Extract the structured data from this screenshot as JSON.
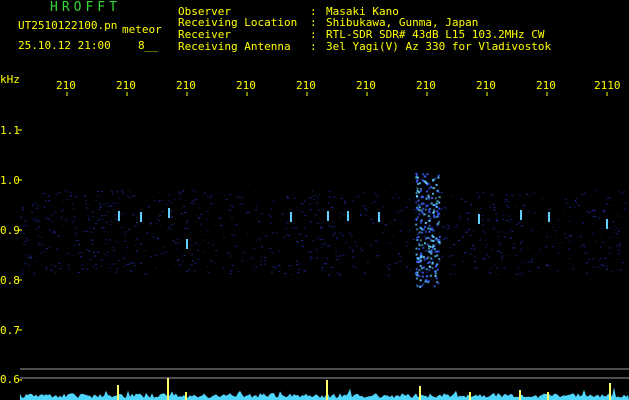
{
  "app": {
    "title": "HROFFT"
  },
  "file": {
    "name": "UT2510122100.pn",
    "mode": "meteor",
    "timestamp": "25.10.12 21:00",
    "count": "8__"
  },
  "header_fields": [
    {
      "label": "Observer",
      "value": "Masaki Kano"
    },
    {
      "label": "Receiving Location",
      "value": "Shibukawa, Gunma, Japan"
    },
    {
      "label": "Receiver",
      "value": "RTL-SDR SDR# 43dB L15 103.2MHz CW"
    },
    {
      "label": "Receiving Antenna",
      "value": "3el Yagi(V) Az 330 for Vladivostok"
    }
  ],
  "axis": {
    "unit": "kHz",
    "x_ticks": [
      "210",
      "210",
      "210",
      "210",
      "210",
      "210",
      "210",
      "210",
      "210",
      "2110"
    ],
    "y_ticks": [
      "1.1",
      "1.0",
      "0.9",
      "0.8",
      "0.7",
      "0.6"
    ]
  },
  "colors": {
    "text": "#ffff00",
    "title": "#33d633",
    "band": "#1e2a9a",
    "signal": "#5fd0ff",
    "level": "#4fd6ff",
    "spike": "#ffff66"
  }
}
